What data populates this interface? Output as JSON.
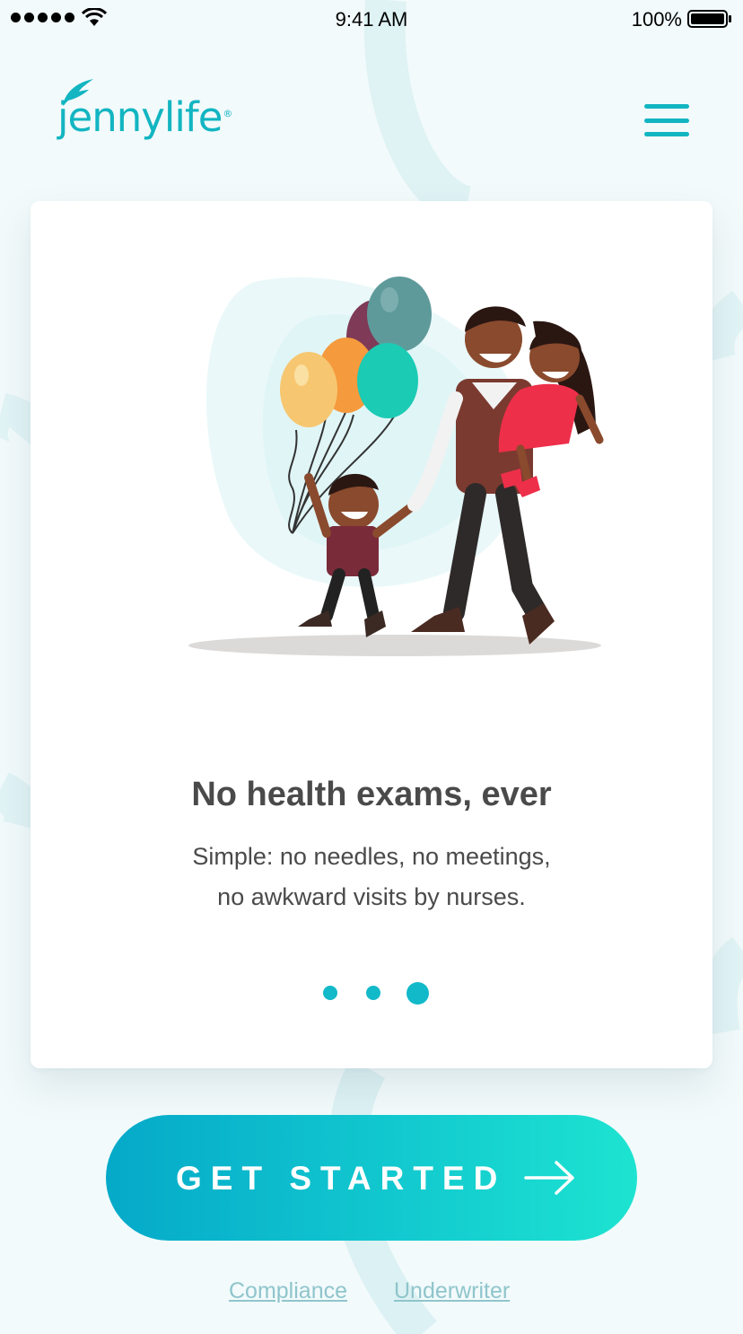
{
  "status_bar": {
    "time": "9:41 AM",
    "battery": "100%",
    "icons": [
      "signal-dots-icon",
      "wifi-icon",
      "battery-icon"
    ]
  },
  "header": {
    "logo_text": "jennylife",
    "logo_mark": "®",
    "menu_icon": "hamburger-menu-icon"
  },
  "card": {
    "illustration": "family-with-balloons-illustration",
    "title": "No health exams, ever",
    "body_lines": [
      "Simple: no needles, no meetings,",
      "no awkward visits by nurses."
    ],
    "pager": {
      "count": 3,
      "active": 3
    }
  },
  "cta": {
    "label": "GET STARTED",
    "icon": "arrow-right-icon"
  },
  "footer": {
    "links": [
      "Compliance",
      "Underwriter"
    ]
  },
  "colors": {
    "brand": "#12b5c1",
    "background": "#f2fafb",
    "text": "#4a4a4a",
    "link": "#8fc5cc",
    "cta_gradient": [
      "#05a9c9",
      "#1de3d0"
    ]
  }
}
